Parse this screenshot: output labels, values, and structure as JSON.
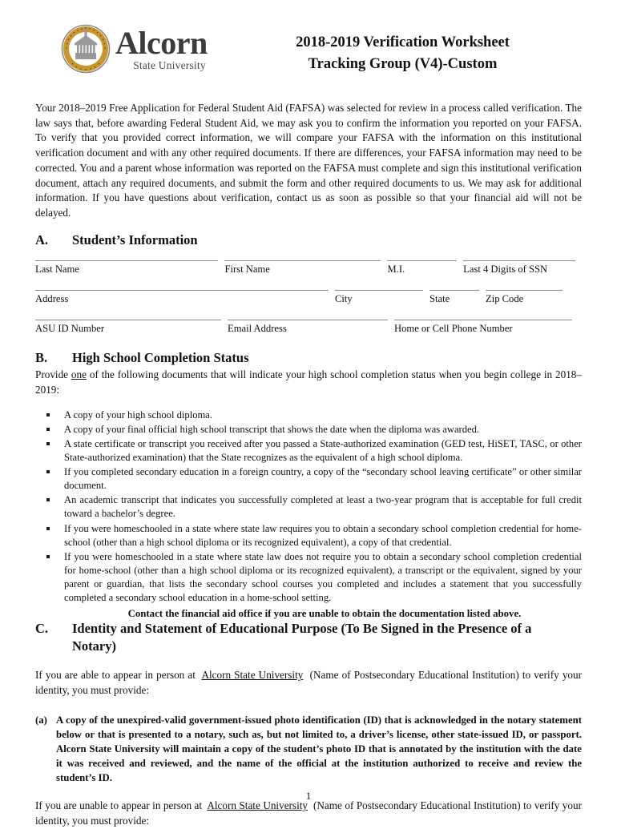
{
  "header": {
    "institution_name": "Alcorn",
    "institution_sub": "State University",
    "seal_icon": "alcorn-state-university-seal",
    "seal_color_gold": "#C9962B",
    "seal_color_ring": "#6E6E6E",
    "title_line1": "2018-2019 Verification Worksheet",
    "title_line2": "Tracking Group (V4)-Custom"
  },
  "intro": {
    "paragraph1": "Your 2018–2019 Free Application for Federal Student Aid (FAFSA) was selected for review in a process called verification. The law says that, before awarding Federal Student Aid, we may ask you to confirm the information you reported on your FAFSA. To verify that you provided correct information, we will compare your FAFSA with the information on this institutional verification document and with any other required documents. If there are differences, your FAFSA information may need to be corrected. You and a parent whose information was reported on the FAFSA must complete and sign this institutional verification document, attach any required documents, and submit the form and other required documents to us. We may ask for additional information. If you have questions about verification, contact us as soon as possible so that your financial aid will not be delayed."
  },
  "section_a": {
    "letter": "A.",
    "title": "Student’s Information",
    "fields": {
      "last_name": "Last Name",
      "first_name": "First Name",
      "mi": "M.I.",
      "ssn": "Last 4 Digits of SSN",
      "address": "Address",
      "city": "City",
      "state": "State",
      "zip": "Zip Code",
      "asu_id": "ASU ID Number",
      "email": "Email Address",
      "phone": "Home or Cell Phone Number"
    },
    "values": {
      "last_name": "",
      "first_name": "",
      "mi": "",
      "ssn": "",
      "address": "",
      "city": "",
      "state": "",
      "zip": "",
      "asu_id": "",
      "email": "",
      "phone": ""
    }
  },
  "section_b": {
    "letter": "B.",
    "title": "High School Completion Status",
    "provide_pre": "Provide ",
    "provide_emph": "one",
    "provide_post": " of the following documents that will indicate your high school completion status when you begin college in 2018–2019:",
    "documents": [
      "A copy of your high school diploma.",
      "A copy of your final official high school transcript that shows the date when the diploma was awarded.",
      "A state certificate or transcript you received after you passed a State-authorized examination (GED test, HiSET, TASC, or other State-authorized examination) that the State recognizes as the equivalent of a high school diploma.",
      "If you completed secondary education in a foreign country, a copy of the “secondary school leaving certificate” or other similar document.",
      "An academic transcript that indicates you successfully completed at least a two-year program that is acceptable for full credit toward a bachelor’s degree.",
      "If you were homeschooled in a state where state law requires you to obtain a secondary school completion credential for home-school (other than a high school diploma or its recognized equivalent), a copy of that credential.",
      "If you were homeschooled in a state where state law does not require you to obtain a secondary school completion credential for home-school (other than a high school diploma or its recognized equivalent), a transcript or the equivalent, signed by your parent or guardian, that lists the secondary school courses you completed and includes a statement that you successfully completed a secondary school education in a home-school setting."
    ],
    "contact_note": "Contact the financial aid office if you are unable to obtain the documentation listed above."
  },
  "section_c": {
    "letter": "C.",
    "title_line1": "Identity and Statement of Educational Purpose (To Be Signed in the Presence",
    "title_line2": "of a Notary)",
    "able_pre": "If you are able to appear in person at",
    "able_institution": "Alcorn State University",
    "able_post": "(Name of Postsecondary Educational Institution) to verify your identity, you must provide:",
    "item_a_marker": "(a)",
    "item_a_text": "A copy of the unexpired-valid government-issued photo identification (ID) that is acknowledged in the notary statement below or that is presented to a notary, such as, but not limited to, a driver’s license, other state-issued ID, or passport. Alcorn State University will maintain a copy of the student’s photo ID that is annotated by the institution with the date it was received and reviewed, and the name of the official at the institution authorized to receive and review the student’s ID.",
    "unable_pre": "If you are unable to appear in person at",
    "unable_institution": "Alcorn State University",
    "unable_post": "(Name of Postsecondary Educational Institution) to verify your identity, you must provide:"
  },
  "footer": {
    "page_number": "1"
  }
}
